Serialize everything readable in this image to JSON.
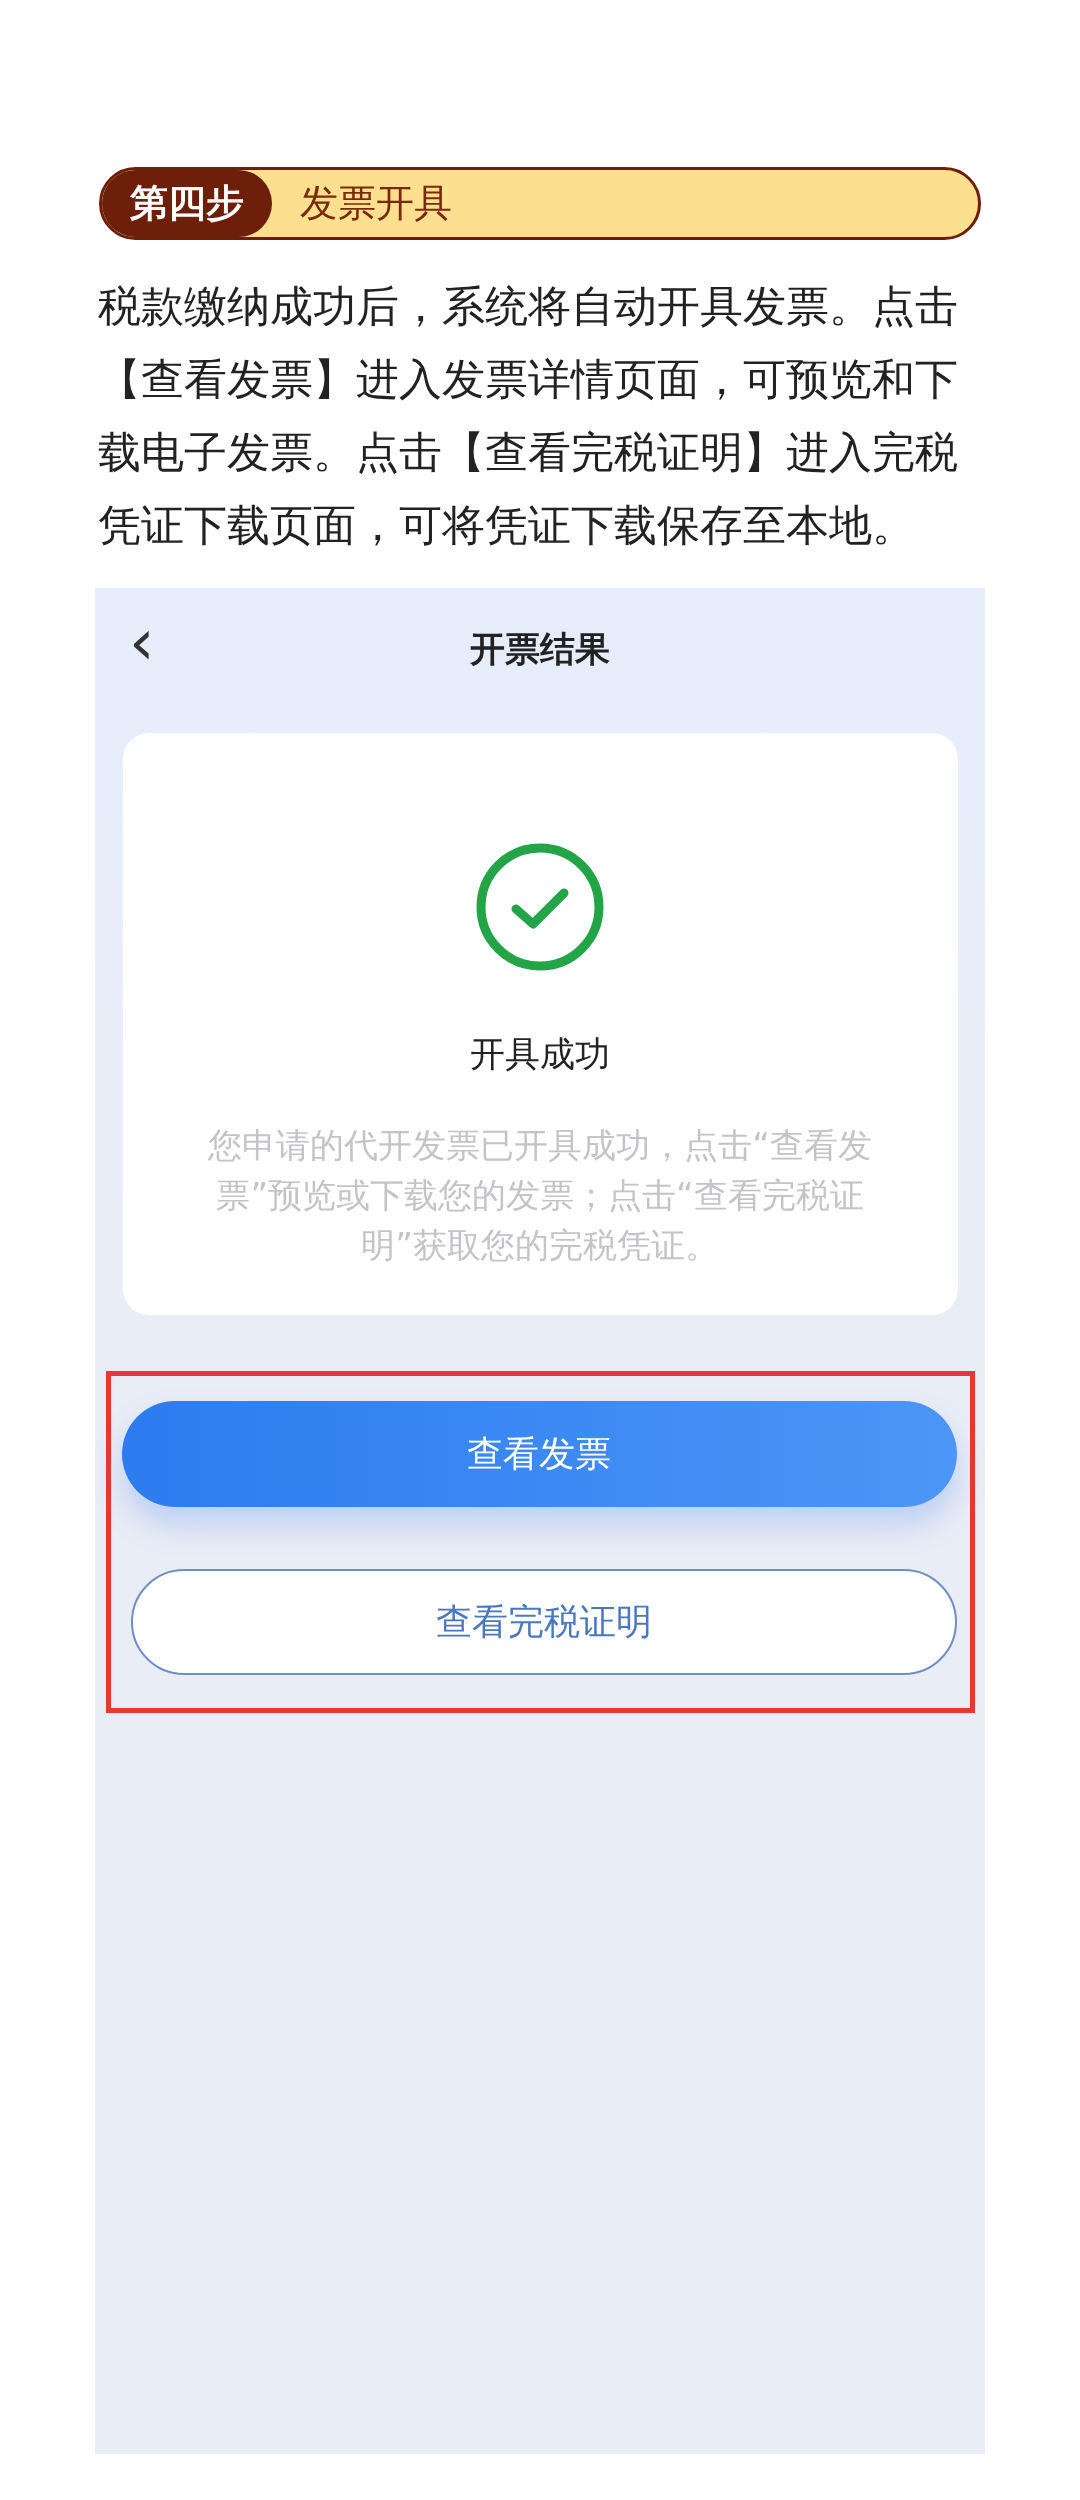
{
  "step_header": {
    "badge": "第四步",
    "title": "发票开具"
  },
  "instructions": "税款缴纳成功后，系统将自动开具发票。点击【查看发票】进入发票详情页面，可预览和下载电子发票。点击【查看完税证明】进入完税凭证下载页面，可将凭证下载保存至本地。",
  "phone_screen": {
    "nav_bar": {
      "back": "‹",
      "title": "开票结果"
    },
    "result_card": {
      "status": "开具成功",
      "message": "您申请的代开发票已开具成功，点击“查看发票”预览或下载您的发票；点击“查看完税证明”获取您的完税凭证。"
    },
    "buttons": [
      {
        "label": "查看发票",
        "kind": "primary"
      },
      {
        "label": "查看完税证明",
        "kind": "outline"
      }
    ]
  }
}
